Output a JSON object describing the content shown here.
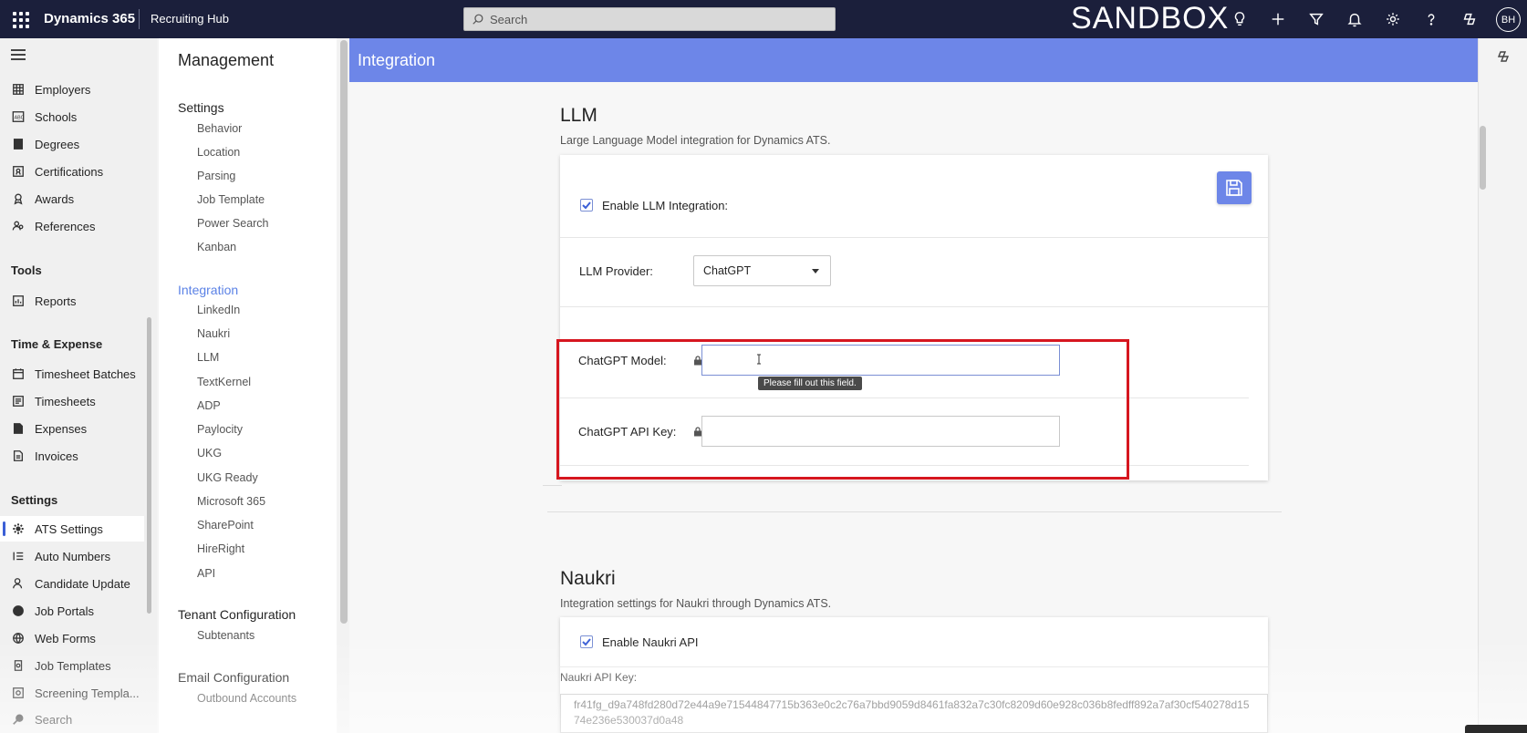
{
  "topbar": {
    "brand": "Dynamics 365",
    "app_name": "Recruiting Hub",
    "search_placeholder": "Search",
    "environment_label": "SANDBOX",
    "icons": [
      "lightbulb-icon",
      "plus-icon",
      "filter-icon",
      "bell-icon",
      "gear-icon",
      "help-icon",
      "copilot-icon"
    ],
    "avatar_initials": "BH"
  },
  "leftnav": {
    "top_items": [
      {
        "label": "Employers",
        "icon": "building-icon"
      },
      {
        "label": "Schools",
        "icon": "abc-icon"
      },
      {
        "label": "Degrees",
        "icon": "book-icon"
      },
      {
        "label": "Certifications",
        "icon": "certificate-icon"
      },
      {
        "label": "Awards",
        "icon": "ribbon-icon"
      },
      {
        "label": "References",
        "icon": "people-icon"
      }
    ],
    "tools_title": "Tools",
    "tools_items": [
      {
        "label": "Reports",
        "icon": "report-icon"
      }
    ],
    "time_title": "Time & Expense",
    "time_items": [
      {
        "label": "Timesheet Batches",
        "icon": "calendar-icon"
      },
      {
        "label": "Timesheets",
        "icon": "timesheet-icon"
      },
      {
        "label": "Expenses",
        "icon": "expense-icon"
      },
      {
        "label": "Invoices",
        "icon": "invoice-icon"
      }
    ],
    "settings_title": "Settings",
    "settings_items": [
      {
        "label": "ATS Settings",
        "icon": "gear-icon",
        "active": true
      },
      {
        "label": "Auto Numbers",
        "icon": "numbered-list-icon"
      },
      {
        "label": "Candidate Update",
        "icon": "person-update-icon"
      },
      {
        "label": "Job Portals",
        "icon": "globe-icon"
      },
      {
        "label": "Web Forms",
        "icon": "form-icon"
      },
      {
        "label": "Job Templates",
        "icon": "template-icon"
      },
      {
        "label": "Screening Templa...",
        "icon": "screening-icon"
      },
      {
        "label": "Search",
        "icon": "search-icon"
      }
    ]
  },
  "management": {
    "title": "Management",
    "settings_group": "Settings",
    "settings_links": [
      "Behavior",
      "Location",
      "Parsing",
      "Job Template",
      "Power Search",
      "Kanban"
    ],
    "integration_group": "Integration",
    "integration_links": [
      "LinkedIn",
      "Naukri",
      "LLM",
      "TextKernel",
      "ADP",
      "Paylocity",
      "UKG",
      "UKG Ready",
      "Microsoft 365",
      "SharePoint",
      "HireRight",
      "API"
    ],
    "tenant_group": "Tenant Configuration",
    "tenant_links": [
      "Subtenants"
    ],
    "email_group": "Email Configuration",
    "email_links": [
      "Outbound Accounts"
    ]
  },
  "main": {
    "banner_title": "Integration",
    "llm": {
      "title": "LLM",
      "description": "Large Language Model integration for Dynamics ATS.",
      "enable_label": "Enable LLM Integration:",
      "enabled": true,
      "provider_label": "LLM Provider:",
      "provider_value": "ChatGPT",
      "model_label": "ChatGPT Model:",
      "model_value": "",
      "api_key_label": "ChatGPT API Key:",
      "api_key_value": "",
      "validation_tooltip": "Please fill out this field."
    },
    "naukri": {
      "title": "Naukri",
      "description": "Integration settings for Naukri through Dynamics ATS.",
      "enable_label": "Enable Naukri API",
      "enabled": true,
      "api_key_label": "Naukri API Key:",
      "api_key_value": "fr41fg_d9a748fd280d72e44a9e71544847715b363e0c2c76a7bbd9059d8461fa832a7c30fc8209d60e928c036b8fedff892a7af30cf540278d1574e236e530037d0a48"
    }
  },
  "colors": {
    "topbar_bg": "#1b1f3b",
    "banner_bg": "#6d86e8",
    "accent": "#5b82e6",
    "highlight_border": "#d6161f"
  }
}
